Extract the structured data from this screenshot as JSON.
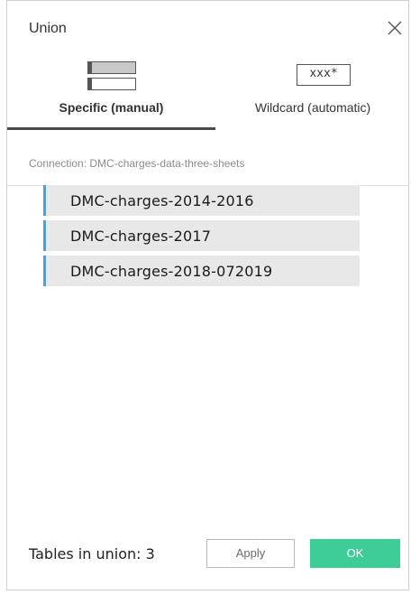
{
  "dialog": {
    "title": "Union",
    "close_icon": "close-icon"
  },
  "tabs": [
    {
      "label": "Specific (manual)",
      "icon": "manual-tables-icon",
      "active": true
    },
    {
      "label": "Wildcard (automatic)",
      "icon_text": "xxx*",
      "active": false
    }
  ],
  "connection_label": "Connection: DMC-charges-data-three-sheets",
  "sheets": [
    {
      "name": "DMC-charges-2014-2016"
    },
    {
      "name": "DMC-charges-2017"
    },
    {
      "name": "DMC-charges-2018-072019"
    }
  ],
  "footer": {
    "tables_in_union": "Tables in union: 3",
    "apply_label": "Apply",
    "ok_label": "OK"
  },
  "colors": {
    "accent_bar": "#5b9ec5",
    "ok_button": "#3ecd97",
    "active_tab_underline": "#4a4a4a"
  }
}
